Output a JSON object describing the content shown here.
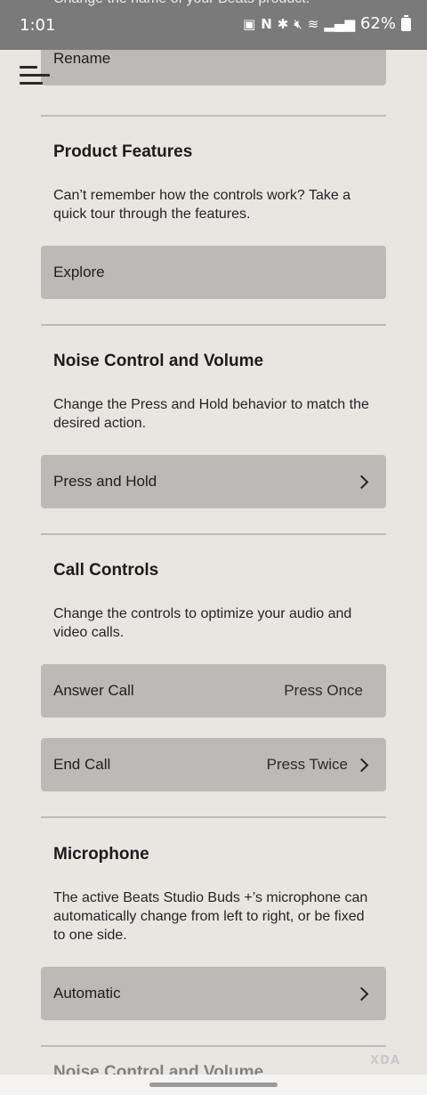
{
  "status_bar": {
    "time": "1:01",
    "battery_percent": "62%",
    "clipped_text": "Change the name of your Beats product.",
    "icons": [
      "photo-icon",
      "nfc-icon",
      "bluetooth-icon",
      "mute-icon",
      "wifi-icon",
      "signal-icon",
      "battery-icon"
    ]
  },
  "menu": {
    "icon": "hamburger-icon"
  },
  "rename": {
    "label": "Rename"
  },
  "product_features": {
    "title": "Product Features",
    "description": "Can’t remember how the controls work? Take a quick tour through the features.",
    "button": "Explore"
  },
  "noise_control": {
    "title": "Noise Control and Volume",
    "description": "Change the Press and Hold behavior to match the desired action.",
    "button": "Press and Hold"
  },
  "call_controls": {
    "title": "Call Controls",
    "description": "Change the controls to optimize your audio and video calls.",
    "answer_label": "Answer Call",
    "answer_value": "Press Once",
    "end_label": "End Call",
    "end_value": "Press Twice"
  },
  "microphone": {
    "title": "Microphone",
    "description": "The active Beats Studio Buds +’s microphone can automatically change from left to right, or be fixed to one side.",
    "button": "Automatic"
  },
  "next_section_peek": "Noise Control and Volume",
  "watermark": "XDA",
  "colors": {
    "background": "#e9e6e2",
    "card": "#bcbab7",
    "status_bar": "#7a7a7a"
  }
}
